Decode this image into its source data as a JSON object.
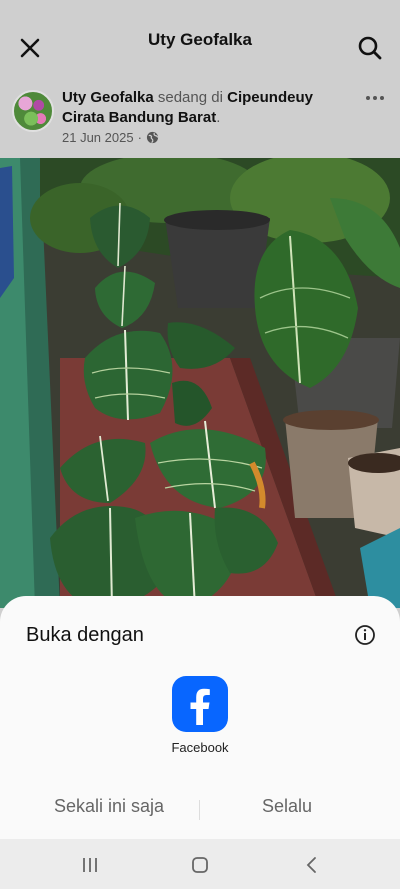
{
  "header": {
    "title": "Uty Geofalka",
    "close_icon": "close-icon",
    "search_icon": "search-icon"
  },
  "post": {
    "author": "Uty Geofalka",
    "connector": "sedang di",
    "location": "Cipeundeuy Cirata Bandung Barat",
    "period": ".",
    "date": "21 Jun 2025",
    "separator": "·",
    "audience_icon": "globe-icon",
    "more_icon": "more-options-icon"
  },
  "sheet": {
    "title": "Buka dengan",
    "info_icon": "info-icon",
    "app": {
      "label": "Facebook",
      "icon": "facebook-icon",
      "color": "#0866FF"
    },
    "once_label": "Sekali ini saja",
    "always_label": "Selalu"
  },
  "navbar": {
    "recents_icon": "recents-icon",
    "home_icon": "home-icon",
    "back_icon": "back-icon"
  }
}
